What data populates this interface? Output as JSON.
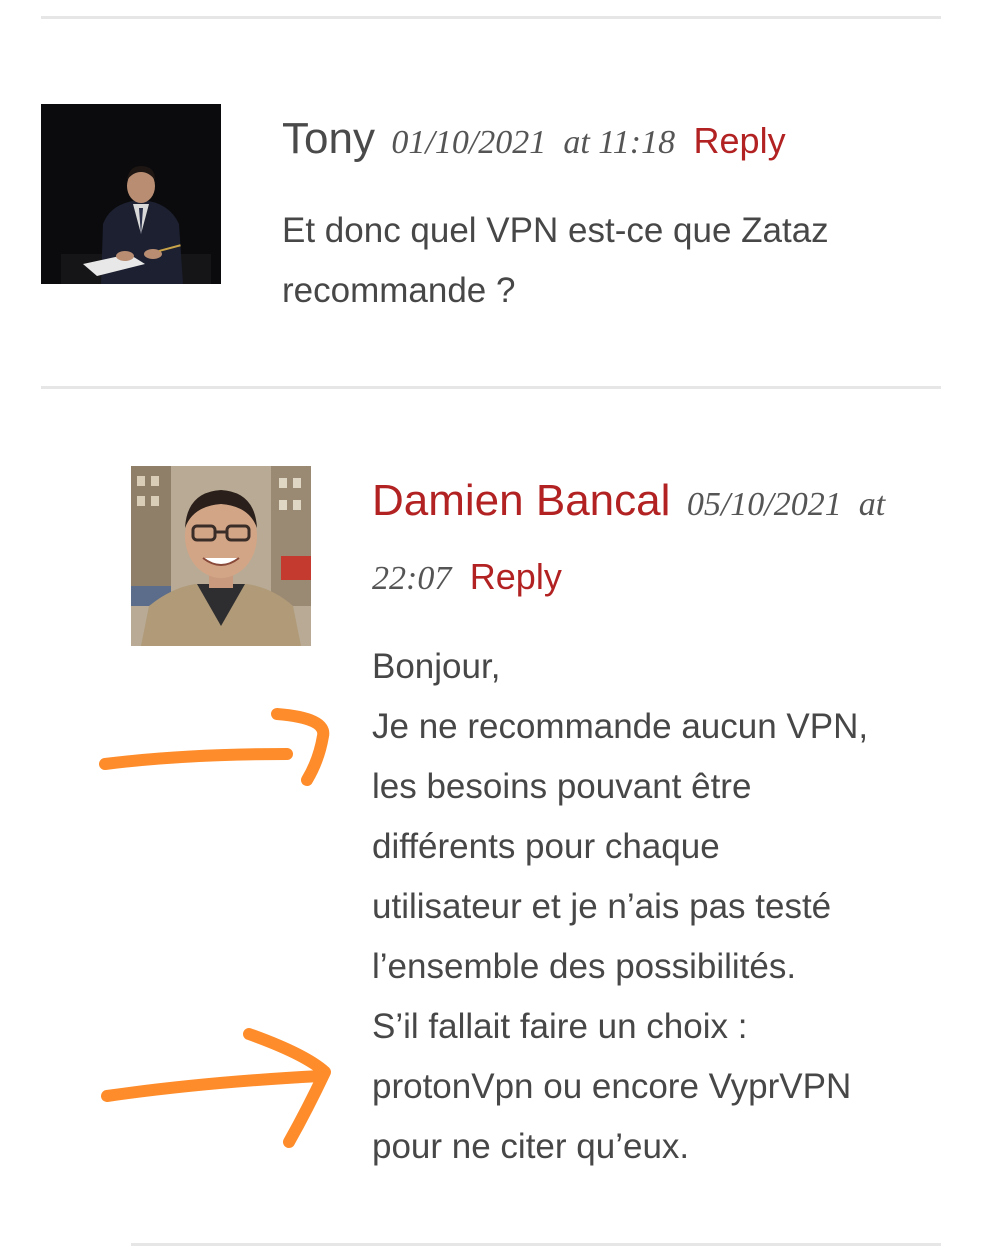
{
  "comments": [
    {
      "author": "Tony",
      "date": "01/10/2021",
      "at": "at",
      "time": "11:18",
      "reply_label": "Reply",
      "lines": [
        "Et donc quel VPN est-ce que Zataz",
        "recommande ?"
      ]
    },
    {
      "author": "Damien Bancal",
      "date": "05/10/2021",
      "at": "at",
      "time": "22:07",
      "reply_label": "Reply",
      "lines": [
        "Bonjour,",
        "Je ne recommande aucun VPN,",
        "les besoins pouvant être",
        "différents pour chaque",
        "utilisateur et je n’ais pas testé",
        "l’ensemble des possibilités.",
        "S’il fallait faire un choix :",
        "protonVpn ou encore VyprVPN",
        "pour ne citer qu’eux."
      ]
    }
  ],
  "colors": {
    "accent": "#b22222",
    "annotation": "#ff8c2a",
    "divider": "#e6e6e6",
    "text": "#474747"
  }
}
